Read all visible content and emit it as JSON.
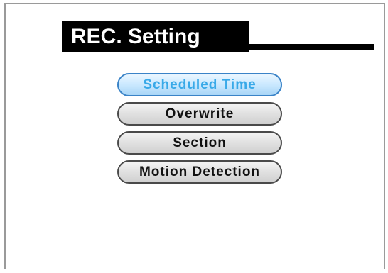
{
  "window": {
    "title": "REC. Setting"
  },
  "menu": {
    "items": [
      {
        "label": "Scheduled Time",
        "selected": true
      },
      {
        "label": "Overwrite",
        "selected": false
      },
      {
        "label": "Section",
        "selected": false
      },
      {
        "label": "Motion Detection",
        "selected": false
      }
    ]
  },
  "colors": {
    "title_bar": "#000000",
    "title_text": "#ffffff",
    "selected_text": "#38a9e8",
    "selected_border": "#3a83c7",
    "button_text": "#111111"
  }
}
